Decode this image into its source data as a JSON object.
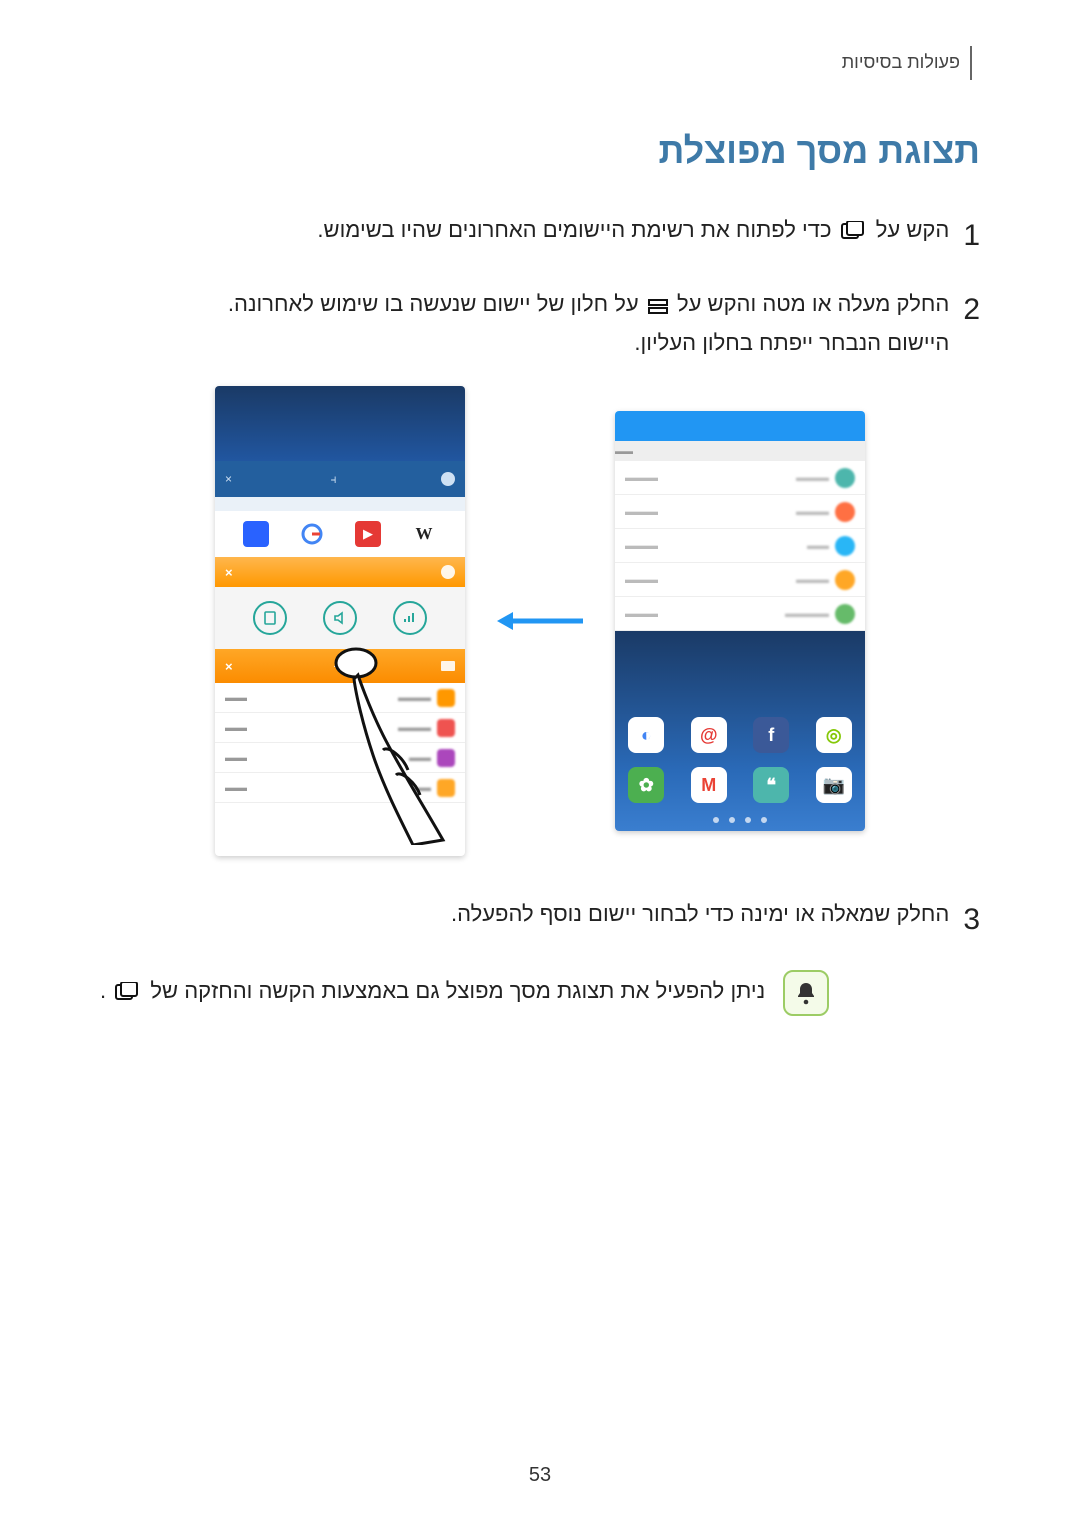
{
  "header": {
    "breadcrumb": "פעולות בסיסיות"
  },
  "title": "תצוגת מסך מפוצלת",
  "steps": {
    "s1_num": "1",
    "s1_text_a": "הקש על ",
    "s1_text_b": " כדי לפתוח את רשימת היישומים האחרונים שהיו בשימוש.",
    "s2_num": "2",
    "s2_text_a": "החלק מעלה או מטה והקש על ",
    "s2_text_b": " על חלון של יישום שנעשה בו שימוש לאחרונה.",
    "s2_sub": "היישום הנבחר ייפתח בחלון העליון.",
    "s3_num": "3",
    "s3_text": "החלק שמאלה או ימינה כדי לבחור יישום נוסף להפעלה."
  },
  "tip": {
    "text_a": "ניתן להפעיל את תצוגת מסך מפוצל גם באמצעות הקשה והחזקה של ",
    "text_b": "."
  },
  "colors": {
    "accent": "#3e7aa8",
    "arrow": "#2196f3",
    "orange": "#ff9800",
    "teal": "#26a69a"
  },
  "right_phone": {
    "status_bar": {
      "left_x": "×",
      "split_icon": "⫞",
      "right_label": "",
      "gear_icon": "gear"
    },
    "white_row_icons": [
      "blue-tile",
      "google-g",
      "youtube",
      "wikipedia-w"
    ],
    "tool_circles": [
      "clipboard",
      "volume",
      "signal"
    ],
    "divider": {
      "x": "×",
      "split_icon": "⫞"
    },
    "list_dots": [
      "#ff9800",
      "#ef5350",
      "#ab47bc",
      "#ffa726"
    ]
  },
  "left_phone": {
    "topbar": {
      "left": "",
      "right": ""
    },
    "list_dots": [
      "#4db6ac",
      "#ff7043",
      "#29b6f6",
      "#ffa726",
      "#66bb6a"
    ],
    "app_row1": [
      {
        "bg": "#ffffff",
        "fg": "#85c808",
        "glyph": "◎"
      },
      {
        "bg": "#3b5998",
        "fg": "#fff",
        "glyph": "f"
      },
      {
        "bg": "#ffffff",
        "fg": "#e53935",
        "glyph": "@"
      },
      {
        "bg": "#ffffff",
        "fg": "#4285f4",
        "glyph": "◐"
      }
    ],
    "app_row2": [
      {
        "bg": "#ffffff",
        "fg": "#8d6e63",
        "glyph": "📷"
      },
      {
        "bg": "#4db6ac",
        "fg": "#fff",
        "glyph": "❝"
      },
      {
        "bg": "#ffffff",
        "fg": "#ea4335",
        "glyph": "M"
      },
      {
        "bg": "#4caf50",
        "fg": "#fff",
        "glyph": "✿"
      }
    ]
  },
  "page_number": "53"
}
